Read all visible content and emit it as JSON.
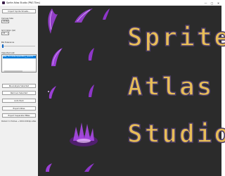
{
  "window": {
    "title": "Sprite Atlas Studio (PNG Tiles)",
    "controls": {
      "minimize": "—",
      "maximize": "□",
      "close": "✕"
    }
  },
  "sidebar": {
    "import_button": "Import Sprite Sheets...",
    "canvas_size_label": "Canvas Size",
    "canvas_size_value": "2048",
    "grid_align_label": "Grid Align (px)",
    "grid_align_value": "16",
    "bg_tolerance_label": "BG Tolerance",
    "bg_tolerance_level": 0.02,
    "imported_list_label": "Imported List",
    "imported_items": [
      "PINK_FX-mobile-Spawnfling_spawnb..."
    ],
    "reanalyze_button": "Re-analyze Selected",
    "remove_button": "Remove Selected",
    "autopack_button": "Auto Pack",
    "export_atlas_button": "Export Atlas",
    "export_separate_button": "Export Separate PNGs",
    "status_text": "Packed: 11 frames → 1024×1024px atlas"
  },
  "canvas": {
    "atlas_text_lines": [
      "Sprite",
      "Atlas",
      "Studio"
    ],
    "background": "#2b2b2b",
    "accent_text_color": "#e7bd58",
    "sprite_color": "#9b3fd6"
  }
}
